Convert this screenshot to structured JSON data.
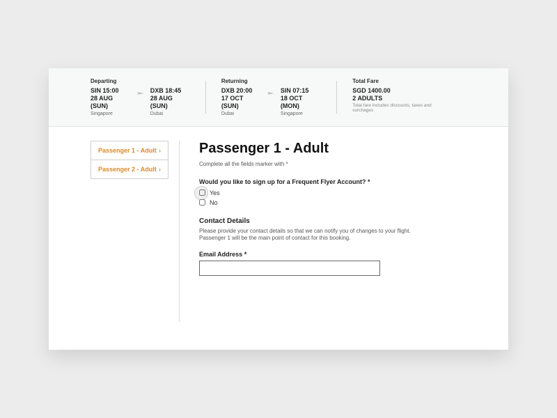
{
  "summary": {
    "departing": {
      "label": "Departing",
      "from": {
        "code_time": "SIN 15:00",
        "date": "28 AUG (SUN)",
        "city": "Singapore"
      },
      "to": {
        "code_time": "DXB 18:45",
        "date": "28 AUG (SUN)",
        "city": "Dubai"
      }
    },
    "returning": {
      "label": "Returning",
      "from": {
        "code_time": "DXB 20:00",
        "date": "17 OCT (SUN)",
        "city": "Dubai"
      },
      "to": {
        "code_time": "SIN 07:15",
        "date": "18 OCT (MON)",
        "city": "Singapore"
      }
    },
    "fare": {
      "label": "Total Fare",
      "amount": "SGD 1400.00",
      "pax": "2 ADULTS",
      "note": "Total fare includes discounts, taxes and surchages"
    }
  },
  "sidebar": {
    "tabs": [
      {
        "label": "Passenger 1 - Adult"
      },
      {
        "label": "Passenger 2 - Adult"
      }
    ]
  },
  "form": {
    "title": "Passenger 1 - Adult",
    "required_hint": "Complete all the fields marker with *",
    "ff_question": "Would you like to sign up for a Frequent Flyer Account? *",
    "opt_yes": "Yes",
    "opt_no": "No",
    "contact_heading": "Contact Details",
    "contact_desc": "Please provide your contact details so that we can notify you of changes to your flight. Passenger 1 will be the main point of contact for this booking.",
    "email_label": "Email Address *",
    "email_value": ""
  }
}
